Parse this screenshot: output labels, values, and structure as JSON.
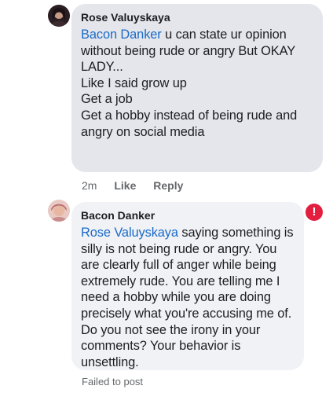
{
  "comments": [
    {
      "author": "Rose Valuyskaya",
      "mention": "Bacon Danker",
      "lines": [
        " u can state ur opinion",
        "without being rude or angry But OKAY",
        "LADY...",
        "Like I said grow up",
        "Get a job",
        "Get a hobby instead of being rude and",
        "angry on social media"
      ],
      "time": "2m",
      "like_label": "Like",
      "reply_label": "Reply"
    },
    {
      "author": "Bacon Danker",
      "mention": "Rose Valuyskaya",
      "lines": [
        " saying something is",
        "silly is not being rude or angry. You",
        "are clearly full of anger while being",
        "extremely rude. You are telling me I",
        "need a hobby while you are doing",
        "precisely what you're accusing me of.",
        "Do you not see the irony in your",
        "comments? Your behavior is",
        "unsettling."
      ],
      "error_glyph": "!",
      "status": "Failed to post"
    }
  ],
  "colors": {
    "mention": "#1b6ac9",
    "bubble": "#e4e6eb",
    "error": "#e41e3f",
    "meta": "#65676b"
  },
  "icons": {
    "avatar_1": "profile-photo",
    "avatar_2": "profile-photo",
    "error": "exclamation-circle-icon"
  }
}
